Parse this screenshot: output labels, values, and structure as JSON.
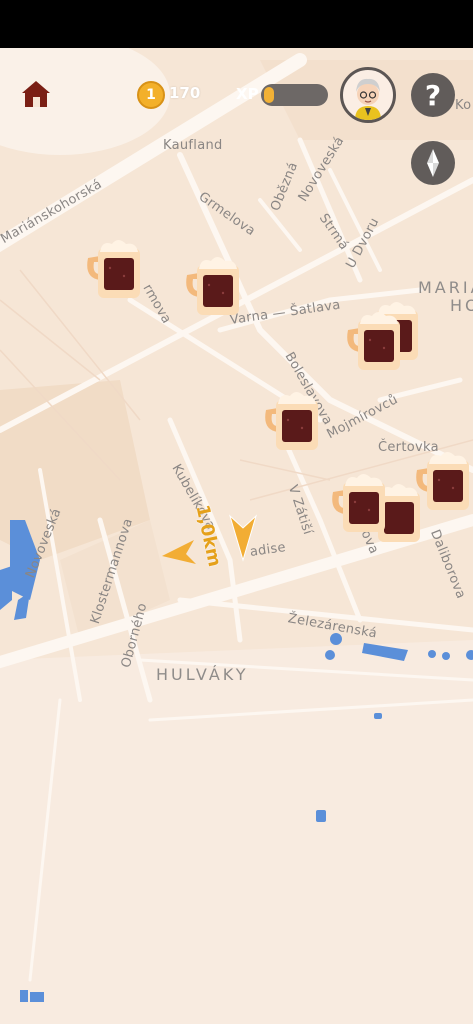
{
  "hud": {
    "coins": "170",
    "xp_label": "XP",
    "xp_progress": 0.08,
    "help_symbol": "?"
  },
  "map": {
    "labels": {
      "marianskohorska": "Mariánskohorská",
      "kaufland": "Kaufland",
      "obezna": "Obězná",
      "novoveska_top": "Novoveská",
      "grmelova": "Grmelova",
      "strma": "Strmá",
      "u_dvoru": "U Dvoru",
      "marianske_hory_1": "MARIÁ",
      "marianske_hory_2": "HO",
      "kova": "Ko",
      "varna": "Varna — Šatlava",
      "mova": "rmova",
      "boleslavova": "Boleslavova",
      "mojmirovcu": "Mojmírovců",
      "certovka": "Čertovka",
      "kubelikova": "Kubelíkova",
      "v_zatisi": "V Zátiší",
      "novoveska_left": "Novoveská",
      "klostermannova": "Klostermannova",
      "paradise": "adise",
      "daliborova": "Daliborova",
      "tova": "Tova",
      "zelezarenska": "Železárenská",
      "oborneho": "Oborného",
      "hulvaky": "HULVÁKY"
    },
    "distance_label": "1,0km",
    "beer_mug_count": 8
  },
  "icons": {
    "home": "home-icon",
    "coin": "coin-icon",
    "avatar": "old-man-avatar",
    "help": "question-icon",
    "compass": "compass-icon",
    "beer": "beer-mug-icon",
    "direction": "direction-arrow-icon"
  },
  "colors": {
    "accent": "#f2b136",
    "hud_button": "#615c5a",
    "map_bg": "#f6e6d6",
    "beer_dark": "#5a1a1a",
    "water": "#5b8fd9"
  }
}
